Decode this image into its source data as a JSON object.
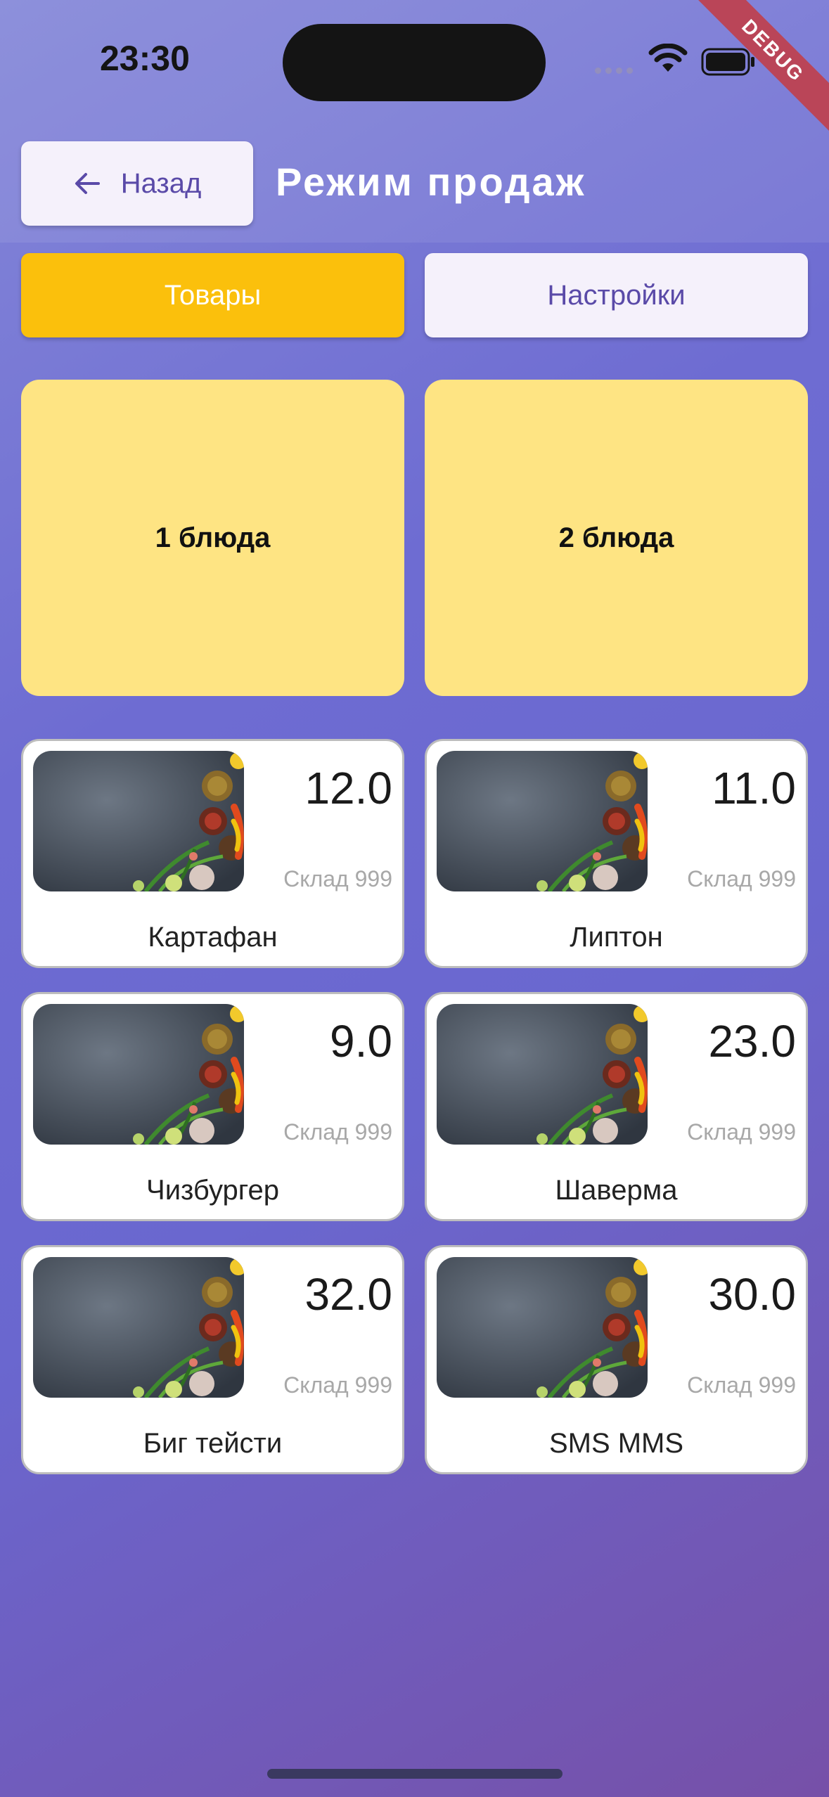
{
  "status_bar": {
    "time": "23:30"
  },
  "debug_label": "DEBUG",
  "header": {
    "back_label": "Назад",
    "title": "Режим продаж"
  },
  "tabs": [
    {
      "label": "Товары",
      "active": true
    },
    {
      "label": "Настройки",
      "active": false
    }
  ],
  "categories": [
    {
      "label": "1 блюда"
    },
    {
      "label": "2 блюда"
    }
  ],
  "products": [
    {
      "name": "Картафан",
      "price": "12.0",
      "stock": "Склад 999"
    },
    {
      "name": "Липтон",
      "price": "11.0",
      "stock": "Склад 999"
    },
    {
      "name": "Чизбургер",
      "price": "9.0",
      "stock": "Склад 999"
    },
    {
      "name": "Шаверма",
      "price": "23.0",
      "stock": "Склад 999"
    },
    {
      "name": "Биг тейсти",
      "price": "32.0",
      "stock": "Склад 999"
    },
    {
      "name": "SMS MMS",
      "price": "30.0",
      "stock": "Склад 999"
    }
  ],
  "colors": {
    "accent_yellow": "#fbc00c",
    "category_bg": "#fee483",
    "button_text": "#5a4aa8"
  }
}
